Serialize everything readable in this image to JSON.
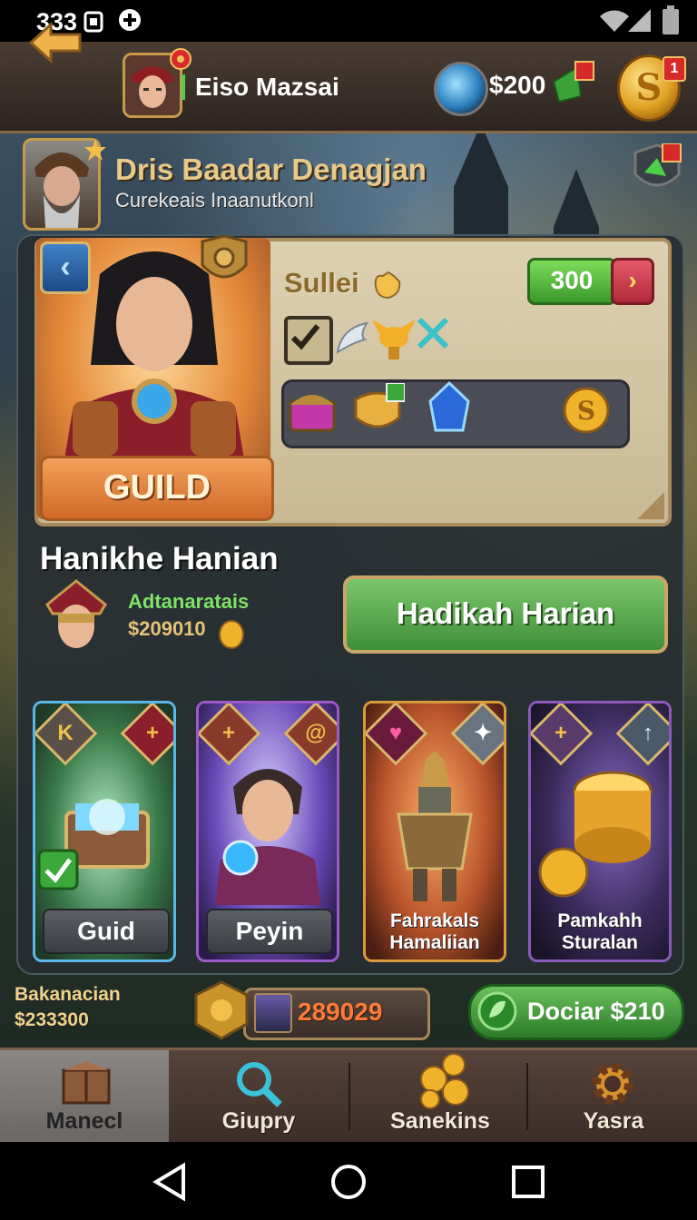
{
  "status_bar": {
    "time": "333"
  },
  "header": {
    "player_name": "Eiso Mazsai",
    "currency_amount": "$200",
    "notification_count": "1"
  },
  "leader": {
    "title": "Dris Baadar Denagjan",
    "subtitle": "Curekeais Inaanutkonl"
  },
  "guild_card": {
    "guild_button_label": "GUILD",
    "label": "Sullei",
    "count": "300"
  },
  "daily": {
    "title": "Hanikhe Hanian",
    "subtitle": "Adtanaratais",
    "amount": "$209010",
    "claim_button": "Hadikah Harian"
  },
  "cards": [
    {
      "label": "Guid",
      "badge": "K"
    },
    {
      "label": "Peyin"
    },
    {
      "label_line1": "Fahrakals",
      "label_line2": "Hamaliian"
    },
    {
      "label_line1": "Pamkahh",
      "label_line2": "Sturalan"
    }
  ],
  "bottom_info": {
    "label": "Bakanacian",
    "amount": "$233300",
    "score": "289029",
    "donate_button": "Dociar $210"
  },
  "nav": {
    "tabs": [
      "Manecl",
      "Giupry",
      "Sanekins",
      "Yasra"
    ],
    "active_index": 0
  },
  "colors": {
    "accent_gold": "#c79a4a",
    "claim_green": "#4ea344",
    "score_orange": "#ff7a3a"
  }
}
